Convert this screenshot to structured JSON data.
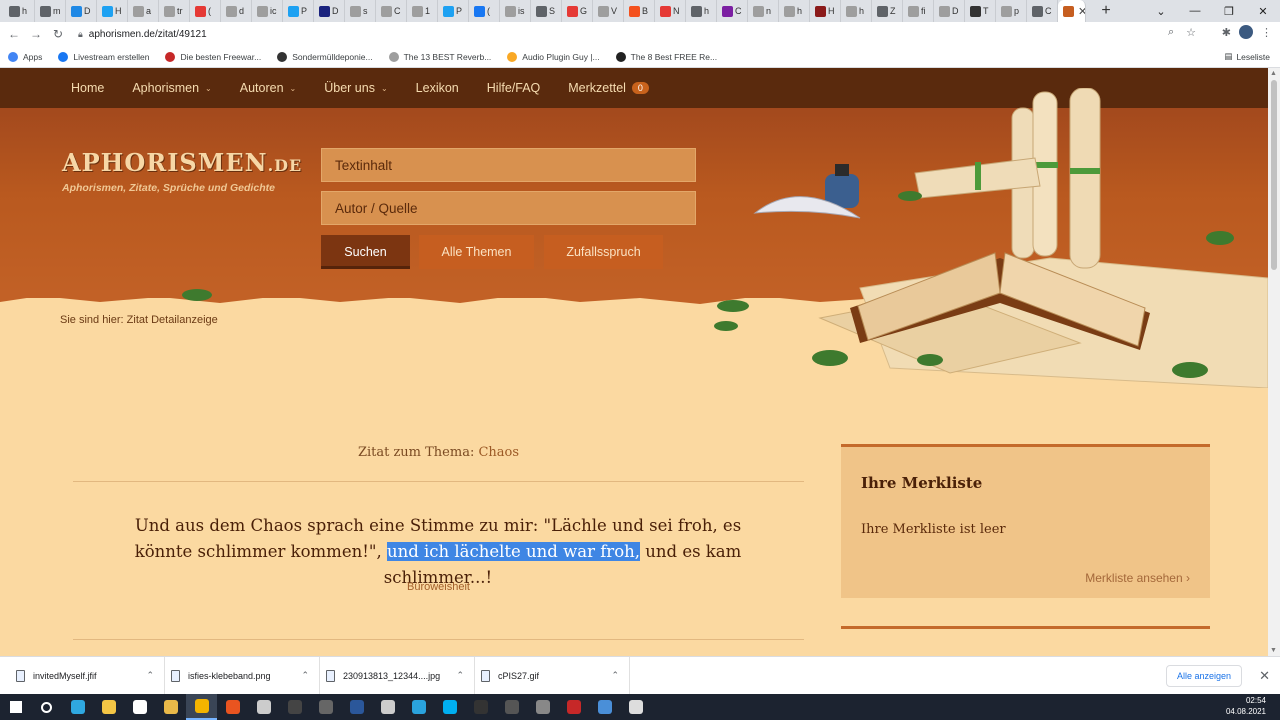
{
  "browser": {
    "tabs": [
      {
        "label": "h",
        "color": "#5f6368"
      },
      {
        "label": "m",
        "color": "#5f6368"
      },
      {
        "label": "D",
        "color": "#1e88e5"
      },
      {
        "label": "H",
        "color": "#1da1f2"
      },
      {
        "label": "a",
        "color": "#9e9e9e"
      },
      {
        "label": "tr",
        "color": "#9e9e9e"
      },
      {
        "label": "(",
        "color": "#e53935"
      },
      {
        "label": "d",
        "color": "#9e9e9e"
      },
      {
        "label": "ic",
        "color": "#9e9e9e"
      },
      {
        "label": "P",
        "color": "#1da1f2"
      },
      {
        "label": "D",
        "color": "#1a237e"
      },
      {
        "label": "s",
        "color": "#9e9e9e"
      },
      {
        "label": "C",
        "color": "#9e9e9e"
      },
      {
        "label": "1",
        "color": "#9e9e9e"
      },
      {
        "label": "P",
        "color": "#1da1f2"
      },
      {
        "label": "(",
        "color": "#1877f2"
      },
      {
        "label": "is",
        "color": "#9e9e9e"
      },
      {
        "label": "S",
        "color": "#5f6368"
      },
      {
        "label": "G",
        "color": "#e53935"
      },
      {
        "label": "V",
        "color": "#9e9e9e"
      },
      {
        "label": "B",
        "color": "#f4511e"
      },
      {
        "label": "N",
        "color": "#e53935"
      },
      {
        "label": "h",
        "color": "#5f6368"
      },
      {
        "label": "C",
        "color": "#7b1fa2"
      },
      {
        "label": "n",
        "color": "#9e9e9e"
      },
      {
        "label": "h",
        "color": "#9e9e9e"
      },
      {
        "label": "H",
        "color": "#8b1a1a"
      },
      {
        "label": "h",
        "color": "#9e9e9e"
      },
      {
        "label": "Z",
        "color": "#5f6368"
      },
      {
        "label": "fi",
        "color": "#9e9e9e"
      },
      {
        "label": "D",
        "color": "#9e9e9e"
      },
      {
        "label": "T",
        "color": "#333333"
      },
      {
        "label": "p",
        "color": "#9e9e9e"
      },
      {
        "label": "C",
        "color": "#5f6368"
      }
    ],
    "active_tab_color": "#c65e20",
    "url": "aphorismen.de/zitat/49121",
    "bookmarks": [
      {
        "label": "Apps",
        "color": "#4285f4"
      },
      {
        "label": "Livestream erstellen",
        "color": "#1877f2"
      },
      {
        "label": "Die besten Freewar...",
        "color": "#c62828"
      },
      {
        "label": "Sondermülldeponie...",
        "color": "#333333"
      },
      {
        "label": "The 13 BEST Reverb...",
        "color": "#9e9e9e"
      },
      {
        "label": "Audio Plugin Guy |...",
        "color": "#f9a825"
      },
      {
        "label": "The 8 Best FREE Re...",
        "color": "#222222"
      }
    ],
    "reading_list": "Leseliste"
  },
  "site": {
    "nav": [
      {
        "label": "Home",
        "has_dropdown": false
      },
      {
        "label": "Aphorismen",
        "has_dropdown": true
      },
      {
        "label": "Autoren",
        "has_dropdown": true
      },
      {
        "label": "Über uns",
        "has_dropdown": true
      },
      {
        "label": "Lexikon",
        "has_dropdown": false
      },
      {
        "label": "Hilfe/FAQ",
        "has_dropdown": false
      },
      {
        "label": "Merkzettel",
        "has_dropdown": false
      }
    ],
    "merkzettel_count": "0",
    "logo": {
      "main": "APHORISMEN",
      "suffix": ".DE"
    },
    "tagline": "Aphorismen, Zitate, Sprüche und Gedichte",
    "search": {
      "text_placeholder": "Textinhalt",
      "author_placeholder": "Autor / Quelle"
    },
    "buttons": {
      "search": "Suchen",
      "all_topics": "Alle Themen",
      "random": "Zufallsspruch"
    },
    "breadcrumb": {
      "prefix": "Sie sind hier:",
      "current": "Zitat Detailanzeige"
    },
    "quote": {
      "heading_prefix": "Zitat zum Thema:",
      "theme": "Chaos",
      "text_before": "Und aus dem Chaos sprach eine Stimme zu mir: \"Lächle und sei froh, es könnte schlimmer kommen!\", ",
      "text_selected": "und ich lächelte und war froh,",
      "text_after": " und es kam schlimmer...!",
      "author": "Büroweisheit"
    },
    "merkliste": {
      "title": "Ihre Merkliste",
      "empty_text": "Ihre Merkliste ist leer",
      "link": "Merkliste ansehen"
    }
  },
  "downloads": {
    "items": [
      "invitedMyself.jfif",
      "isfies-klebeband.png",
      "230913813_12344....jpg",
      "cPIS27.gif"
    ],
    "show_all": "Alle anzeigen"
  },
  "taskbar": {
    "icons": [
      {
        "name": "windows-icon",
        "color": "#ffffff"
      },
      {
        "name": "search-icon",
        "color": "#ffffff"
      },
      {
        "name": "edge-icon",
        "color": "#2fa8e0"
      },
      {
        "name": "file-explorer-icon",
        "color": "#f3c545"
      },
      {
        "name": "store-icon",
        "color": "#ffffff"
      },
      {
        "name": "folder-icon",
        "color": "#e9b949"
      },
      {
        "name": "chrome-icon",
        "color": "#f4b400"
      },
      {
        "name": "ubuntu-icon",
        "color": "#e95420"
      },
      {
        "name": "app-icon",
        "color": "#cccccc"
      },
      {
        "name": "app-icon",
        "color": "#444444"
      },
      {
        "name": "app-icon",
        "color": "#666666"
      },
      {
        "name": "app-icon",
        "color": "#2b579a"
      },
      {
        "name": "app-icon",
        "color": "#cccccc"
      },
      {
        "name": "telegram-icon",
        "color": "#2aa3dd"
      },
      {
        "name": "skype-icon",
        "color": "#00aff0"
      },
      {
        "name": "app-icon",
        "color": "#333333"
      },
      {
        "name": "app-icon",
        "color": "#555555"
      },
      {
        "name": "app-icon",
        "color": "#888888"
      },
      {
        "name": "app-icon",
        "color": "#c62828"
      },
      {
        "name": "app-icon",
        "color": "#4a8fd8"
      },
      {
        "name": "app-icon",
        "color": "#dddddd"
      }
    ],
    "time": "02:54",
    "date": "04.08.2021"
  }
}
